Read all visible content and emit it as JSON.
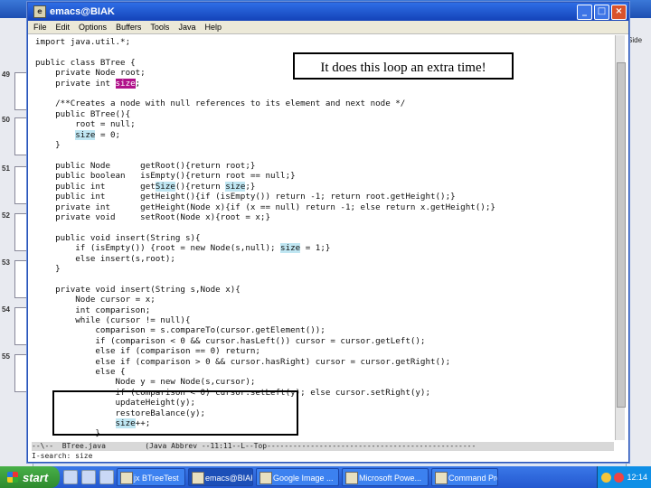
{
  "emacs": {
    "title": "emacs@BIAK",
    "menu": [
      "File",
      "Edit",
      "Options",
      "Buffers",
      "Tools",
      "Java",
      "Help"
    ],
    "buttons": {
      "minimize": "_",
      "maximize": "□",
      "close": "×"
    }
  },
  "code": {
    "lines": [
      [
        {
          "t": "import java.util.*;"
        }
      ],
      [
        {
          "t": ""
        }
      ],
      [
        {
          "t": "public class BTree {"
        }
      ],
      [
        {
          "t": "    private Node root;"
        }
      ],
      [
        {
          "t": "    private int "
        },
        {
          "t": "size",
          "h": "m"
        },
        {
          "t": ";"
        }
      ],
      [
        {
          "t": ""
        }
      ],
      [
        {
          "t": "    /**Creates a node with null references to its element and next node */"
        }
      ],
      [
        {
          "t": "    public BTree(){"
        }
      ],
      [
        {
          "t": "        root = null;"
        }
      ],
      [
        {
          "t": "        "
        },
        {
          "t": "size",
          "h": "c"
        },
        {
          "t": " = 0;"
        }
      ],
      [
        {
          "t": "    }"
        }
      ],
      [
        {
          "t": ""
        }
      ],
      [
        {
          "t": "    public Node      getRoot(){return root;}"
        }
      ],
      [
        {
          "t": "    public boolean   isEmpty(){return root == null;}"
        }
      ],
      [
        {
          "t": "    public int       get"
        },
        {
          "t": "Size",
          "h": "c"
        },
        {
          "t": "(){return "
        },
        {
          "t": "size",
          "h": "c"
        },
        {
          "t": ";}"
        }
      ],
      [
        {
          "t": "    public int       getHeight(){if (isEmpty()) return -1; return root.getHeight();}"
        }
      ],
      [
        {
          "t": "    private int      getHeight(Node x){if (x == null) return -1; else return x.getHeight();}"
        }
      ],
      [
        {
          "t": "    private void     setRoot(Node x){root = x;}"
        }
      ],
      [
        {
          "t": ""
        }
      ],
      [
        {
          "t": "    public void insert(String s){"
        }
      ],
      [
        {
          "t": "        if (isEmpty()) {root = new Node(s,null); "
        },
        {
          "t": "size",
          "h": "c"
        },
        {
          "t": " = 1;}"
        }
      ],
      [
        {
          "t": "        else insert(s,root);"
        }
      ],
      [
        {
          "t": "    }"
        }
      ],
      [
        {
          "t": ""
        }
      ],
      [
        {
          "t": "    private void insert(String s,Node x){"
        }
      ],
      [
        {
          "t": "        Node cursor = x;"
        }
      ],
      [
        {
          "t": "        int comparison;"
        }
      ],
      [
        {
          "t": "        while (cursor != null){"
        }
      ],
      [
        {
          "t": "            comparison = s.compareTo(cursor.getElement());"
        }
      ],
      [
        {
          "t": "            if (comparison < 0 && cursor.hasLeft()) cursor = cursor.getLeft();"
        }
      ],
      [
        {
          "t": "            else if (comparison == 0) return;"
        }
      ],
      [
        {
          "t": "            else if (comparison > 0 && cursor.hasRight) cursor = cursor.getRight();"
        }
      ],
      [
        {
          "t": "            else {"
        }
      ],
      [
        {
          "t": "                Node y = new Node(s,cursor);"
        }
      ],
      [
        {
          "t": "                if (comparison < 0) cursor.setLeft(y); else cursor.setRight(y);"
        }
      ],
      [
        {
          "t": "                updateHeight(y);"
        }
      ],
      [
        {
          "t": "                restoreBalance(y);"
        }
      ],
      [
        {
          "t": "                "
        },
        {
          "t": "size",
          "h": "c"
        },
        {
          "t": "++;"
        }
      ],
      [
        {
          "t": "            }"
        }
      ],
      [
        {
          "t": "        }"
        }
      ]
    ]
  },
  "modeline": "--\\--  BTree.java         (Java Abbrev --11:11--L--Top------------------------------------------------",
  "minibuffer": "I-search: size",
  "callout": "It does this loop an extra time!",
  "background_app": {
    "slide_numbers": [
      "49",
      "50",
      "51",
      "52",
      "53",
      "54",
      "55"
    ],
    "right_label": "Side"
  },
  "taskbar": {
    "start": "start",
    "tasks": [
      {
        "label": "jx BTreeTest",
        "active": false
      },
      {
        "label": "emacs@BIAK",
        "active": true
      },
      {
        "label": "Google Image ...",
        "active": false
      },
      {
        "label": "Microsoft Powe...",
        "active": false
      },
      {
        "label": "Command Pro...",
        "active": false
      }
    ],
    "clock": "12:14"
  }
}
